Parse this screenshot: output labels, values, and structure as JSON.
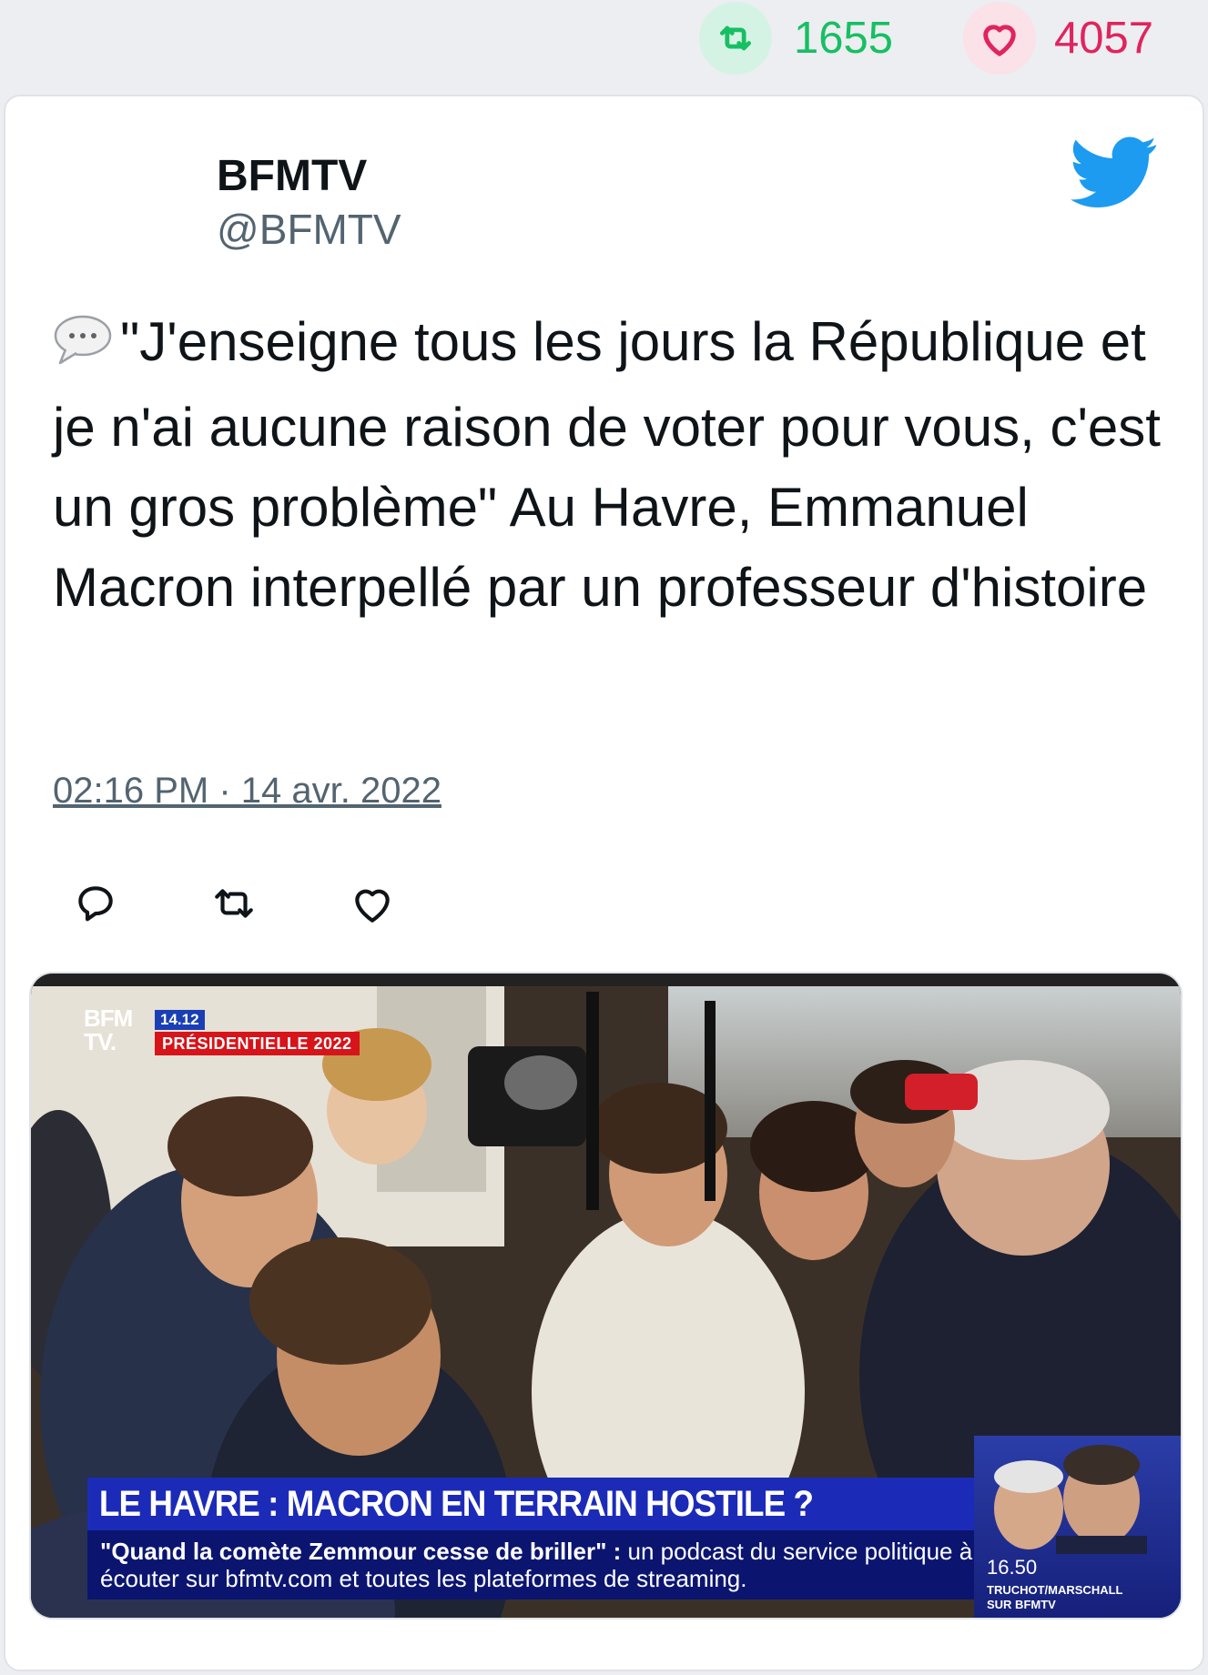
{
  "stats": {
    "retweets": "1655",
    "likes": "4057",
    "retweet_color": "#17bf63",
    "like_color": "#e0245e"
  },
  "author": {
    "name": "BFMTV",
    "handle": "@BFMTV"
  },
  "tweet": {
    "emoji_icon": "speech-bubble-icon",
    "text": "\"J'enseigne tous les jours la République et je n'ai aucune raison de voter pour vous, c'est un gros problème\" Au Havre, Emmanuel Macron interpellé par un professeur d'histoire",
    "timestamp": "02:16 PM · 14 avr. 2022"
  },
  "actions": [
    "reply-icon",
    "retweet-icon",
    "like-icon"
  ],
  "media": {
    "channel_logo_line1": "BFM",
    "channel_logo_line2": "TV.",
    "time_badge": "14.12",
    "section_badge": "PRÉSIDENTIELLE 2022",
    "headline": "LE HAVRE : MACRON EN TERRAIN HOSTILE ?",
    "subline_bold": "\"Quand la comète Zemmour cesse de briller\" :",
    "subline_rest": " un podcast du service politique à écouter sur bfmtv.com et toutes les plateformes de streaming.",
    "promo_time": "16.50",
    "promo_line1": "TRUCHOT/MARSCHALL",
    "promo_line2": "SUR BFMTV"
  },
  "colors": {
    "twitter_blue": "#1d9bf0",
    "bfm_blue": "#1b2bb8",
    "bfm_red": "#d7141a"
  }
}
